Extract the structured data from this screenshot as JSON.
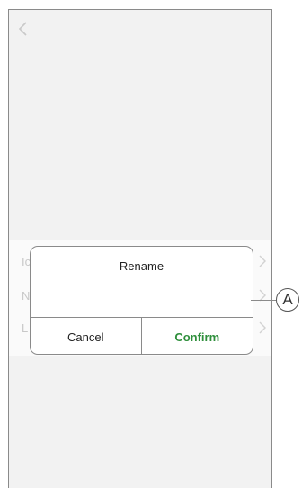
{
  "background_list": {
    "rows": [
      {
        "label": "Ic"
      },
      {
        "label": "N"
      },
      {
        "label": "L"
      }
    ]
  },
  "rename_dialog": {
    "title": "Rename",
    "input_value": "",
    "cancel_label": "Cancel",
    "confirm_label": "Confirm"
  },
  "annotation": {
    "callout_label": "A"
  },
  "colors": {
    "confirm": "#2f8f3c",
    "border": "#8a8a8a"
  },
  "icons": [
    "chevron-left-icon",
    "chevron-right-icon"
  ]
}
